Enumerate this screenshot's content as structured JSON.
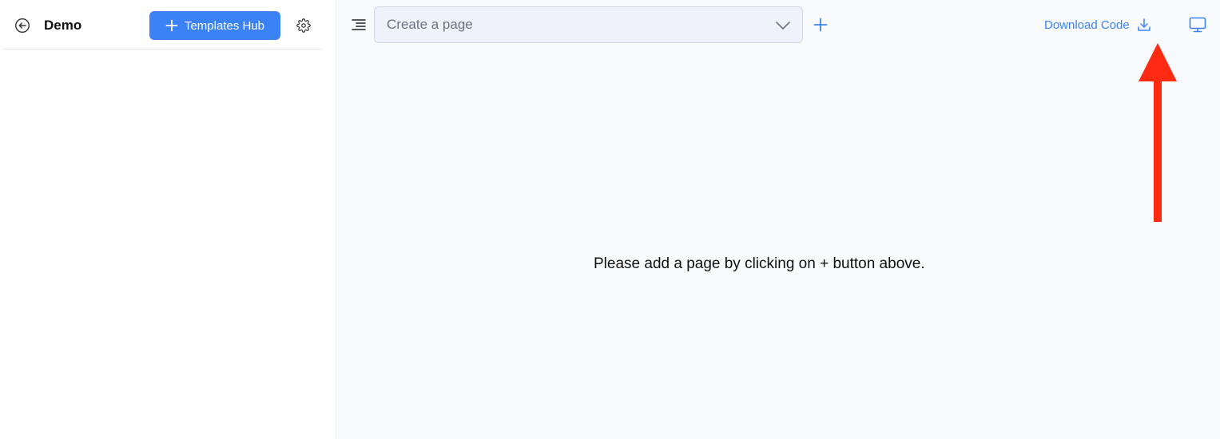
{
  "sidebar": {
    "back_icon": "arrow-left-circle-icon",
    "project_title": "Demo",
    "templates_hub_label": "Templates Hub",
    "templates_hub_icon": "plus-icon",
    "settings_icon": "gear-icon"
  },
  "toolbar": {
    "menu_icon": "align-right-lines-icon",
    "page_select": {
      "placeholder": "Create a page",
      "icon": "chevron-down-icon"
    },
    "add_page_icon": "plus-icon",
    "download_label": "Download Code",
    "download_icon": "download-icon",
    "preview_icon": "monitor-icon"
  },
  "main": {
    "empty_message": "Please add a page by clicking on + button above."
  },
  "annotation": {
    "arrow_color": "#ff2a12",
    "arrow_icon": "arrow-up-icon"
  },
  "colors": {
    "accent": "#3b82f6",
    "canvas_bg": "#f8fafc",
    "select_bg": "#eef3fb"
  }
}
